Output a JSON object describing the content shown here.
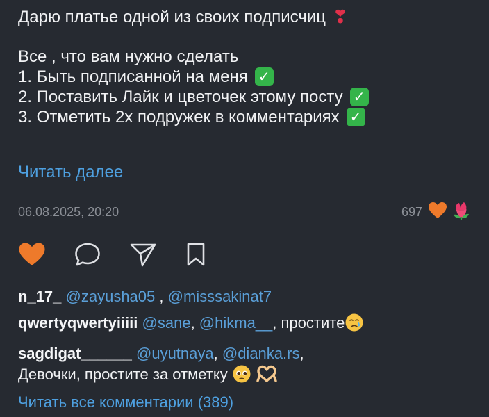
{
  "caption": {
    "title": "Дарю платье одной из своих подписчиц",
    "intro": "Все , что вам нужно сделать",
    "steps": [
      "1. Быть подписанной на меня",
      "2. Поставить Лайк и цветочек этому посту",
      "3. Отметить 2х подружек в комментариях"
    ],
    "check_glyph": "✓",
    "heart_glyph": "❣"
  },
  "read_more": "Читать далее",
  "meta": {
    "date": "06.08.2025, 20:20",
    "reactions_count": "697"
  },
  "icons": {
    "like": "heart-icon",
    "comment": "comment-icon",
    "share": "send-icon",
    "bookmark": "bookmark-icon",
    "reaction_heart": "heart-reaction-icon",
    "reaction_flower": "tulip-reaction-icon"
  },
  "colors": {
    "background": "#262a31",
    "like": "#ee7a2b",
    "link": "#4ea0e0",
    "check": "#34b44a",
    "flower": "#e8386a"
  },
  "comments": [
    {
      "user": "n_17_",
      "mentions": [
        "@zayusha05",
        "@misssakinat7"
      ],
      "text": ""
    },
    {
      "user": "qwertyqwertyiiiii",
      "mentions": [
        "@sane",
        "@hikma__"
      ],
      "text": "простите"
    },
    {
      "user": "sagdigat______",
      "mentions": [
        "@uyutnaya",
        "@dianka.rs"
      ],
      "text": "Девочки, простите за отметку"
    }
  ],
  "all_comments": "Читать все комментарии (389)"
}
